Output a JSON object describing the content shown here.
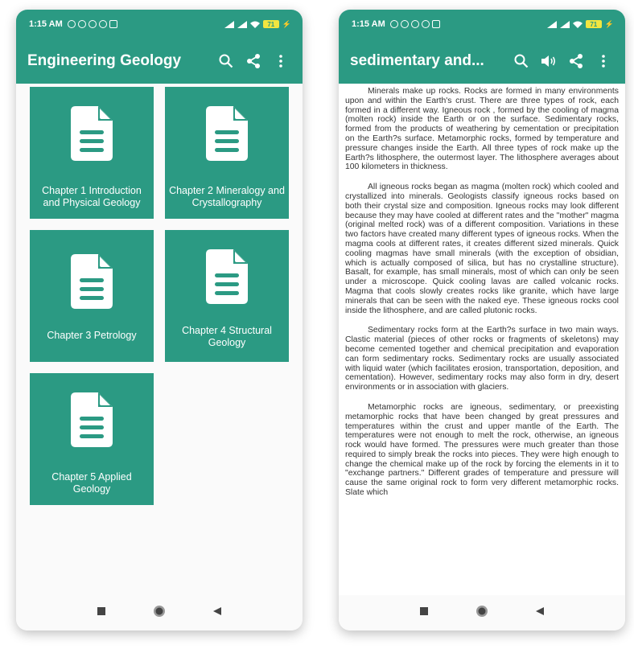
{
  "status": {
    "time": "1:15 AM",
    "battery": "71"
  },
  "left_screen": {
    "app_title": "Engineering Geology",
    "chapters": [
      {
        "label": "Chapter 1 Introduction and Physical Geology"
      },
      {
        "label": "Chapter 2 Mineralogy and Crystallography"
      },
      {
        "label": "Chapter 3 Petrology"
      },
      {
        "label": "Chapter 4 Structural Geology"
      },
      {
        "label": "Chapter 5 Applied Geology"
      }
    ]
  },
  "right_screen": {
    "title": "sedimentary and...",
    "paragraphs": [
      "Minerals make up rocks. Rocks are formed in many environments upon and within the Earth's crust. There are three types of rock, each formed in a different way. Igneous rock , formed by the cooling of magma (molten rock) inside the Earth or on the surface. Sedimentary rocks, formed from the products of weathering by cementation or precipitation on the Earth?s surface. Metamorphic rocks, formed by temperature and pressure changes inside the Earth. All three types of rock make up the Earth?s lithosphere, the outermost layer. The lithosphere averages about 100 kilometers in thickness.",
      "All igneous rocks began as magma (molten rock) which cooled and crystallized into minerals. Geologists classify igneous rocks based on both their crystal size and composition. Igneous rocks may look different because they may have cooled at different rates and the \"mother\" magma (original melted rock) was of a different composition. Variations in these two factors have created many different types of igneous rocks. When the magma cools at different rates, it creates different sized minerals. Quick cooling magmas have small minerals (with the exception of obsidian, which is actually composed of silica, but has no crystalline structure). Basalt, for example, has small minerals, most of which can only be seen under a microscope. Quick cooling lavas are called volcanic rocks. Magma that cools slowly creates rocks like granite, which have large minerals that can be seen with the naked eye. These igneous rocks cool inside the lithosphere, and are called plutonic rocks.",
      "Sedimentary rocks form at the Earth?s surface in two main ways. Clastic material (pieces of other rocks or fragments of skeletons) may become cemented together and chemical precipitation and evaporation can form sedimentary rocks. Sedimentary rocks are usually associated with liquid water (which facilitates erosion, transportation, deposition, and cementation). However, sedimentary rocks may also form in dry, desert environments or in association with glaciers.",
      "Metamorphic rocks are igneous, sedimentary, or preexisting metamorphic rocks that have been changed by great pressures and temperatures within the crust and upper mantle of the Earth. The temperatures were not enough to melt the rock, otherwise, an igneous rock would have formed. The pressures were much greater than those required to simply break the rocks into pieces. They were high enough to change the chemical make up of the rock by forcing the elements in it to \"exchange partners.\" Different grades of temperature and pressure will cause the same original rock to form very different metamorphic rocks. Slate which"
    ]
  },
  "colors": {
    "accent": "#2b9a83",
    "battery": "#f2e640"
  },
  "icons": {
    "appbar": [
      "search-icon",
      "share-icon",
      "more-vert-icon"
    ],
    "appbar_right": [
      "search-icon",
      "speaker-icon",
      "share-icon",
      "more-vert-icon"
    ],
    "card": "document-icon",
    "navbar": [
      "recents-square-icon",
      "home-circle-icon",
      "back-triangle-icon"
    ]
  }
}
